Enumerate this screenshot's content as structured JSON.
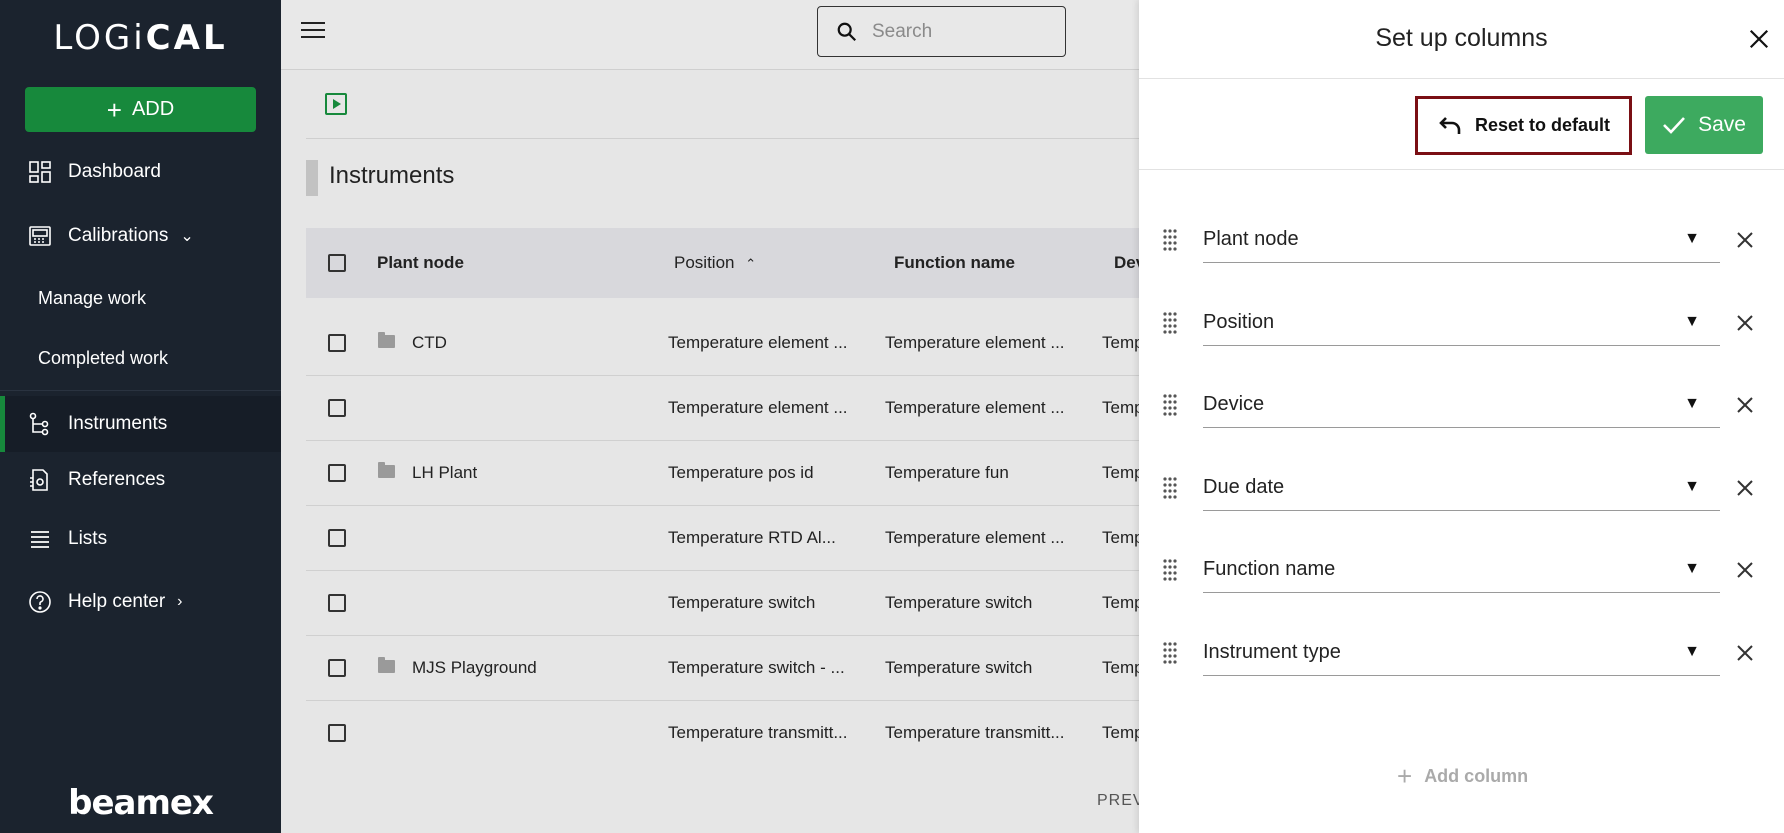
{
  "sidebar": {
    "logo": {
      "part1": "LOGi",
      "part2": "CAL"
    },
    "add_label": "ADD",
    "items": [
      {
        "label": "Dashboard"
      },
      {
        "label": "Calibrations"
      },
      {
        "label": "Manage work"
      },
      {
        "label": "Completed work"
      },
      {
        "label": "Instruments"
      },
      {
        "label": "References"
      },
      {
        "label": "Lists"
      },
      {
        "label": "Help center"
      }
    ],
    "brand": "beamex"
  },
  "search": {
    "placeholder": "Search"
  },
  "page": {
    "title": "Instruments"
  },
  "table": {
    "headers": [
      "Plant node",
      "Position",
      "Function name",
      "Dev"
    ],
    "rows": [
      {
        "plant_node": "CTD",
        "position": "Temperature element ...",
        "function": "Temperature element ...",
        "dev": "Temp"
      },
      {
        "plant_node": "",
        "position": "Temperature element ...",
        "function": "Temperature element ...",
        "dev": "Temp"
      },
      {
        "plant_node": "LH Plant",
        "position": "Temperature pos id",
        "function": "Temperature fun",
        "dev": "Temp"
      },
      {
        "plant_node": "",
        "position": "Temperature RTD Al...",
        "function": "Temperature element ...",
        "dev": "Temp"
      },
      {
        "plant_node": "",
        "position": "Temperature switch",
        "function": "Temperature switch",
        "dev": "Temp"
      },
      {
        "plant_node": "MJS Playground",
        "position": "Temperature switch - ...",
        "function": "Temperature switch",
        "dev": "Temp"
      },
      {
        "plant_node": "",
        "position": "Temperature transmitt...",
        "function": "Temperature transmitt...",
        "dev": "Temp"
      }
    ],
    "pagination_prev": "PREV"
  },
  "panel": {
    "title": "Set up columns",
    "reset_label": "Reset to default",
    "save_label": "Save",
    "columns": [
      "Plant node",
      "Position",
      "Device",
      "Due date",
      "Function name",
      "Instrument type"
    ],
    "add_column_label": "Add column"
  },
  "colors": {
    "accent_green": "#17893c",
    "save_green": "#3daa5f",
    "sidebar_bg": "#1b232e",
    "highlight_border": "#7a0f14"
  }
}
